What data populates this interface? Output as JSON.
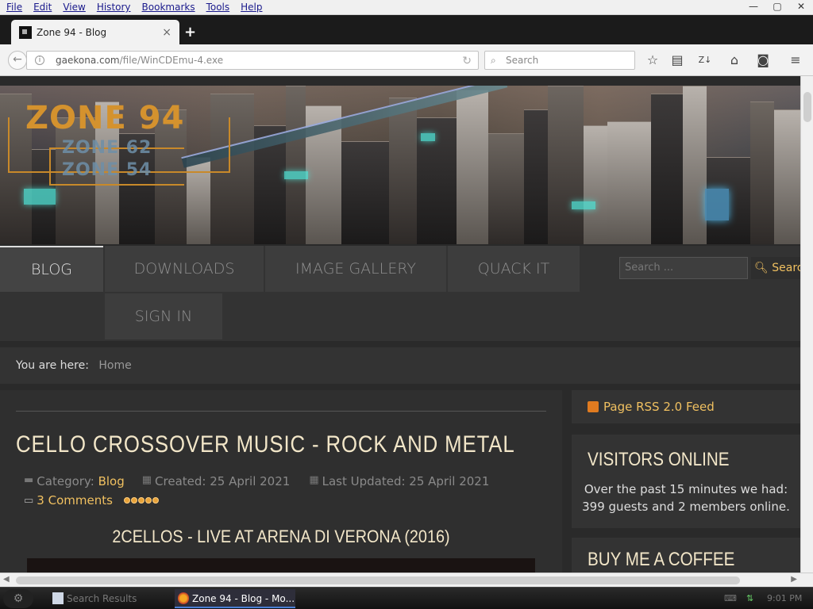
{
  "menubar": {
    "items": [
      "File",
      "Edit",
      "View",
      "History",
      "Bookmarks",
      "Tools",
      "Help"
    ],
    "minimize": "—",
    "maximize": "▢",
    "close": "✕"
  },
  "tab": {
    "title": "Zone 94 - Blog",
    "close": "×",
    "new_tab": "+"
  },
  "navbar": {
    "url_host": "gaekona.com",
    "url_path": "/file/WinCDEmu-4.exe",
    "search_placeholder": "Search"
  },
  "banner": {
    "logo_main": "ZONE 94",
    "logo_sub1": "ZONE 62",
    "logo_sub2": "ZONE 54"
  },
  "sitenav": {
    "items": [
      {
        "label": "BLOG",
        "active": true
      },
      {
        "label": "DOWNLOADS"
      },
      {
        "label": "IMAGE GALLERY"
      },
      {
        "label": "QUACK IT"
      },
      {
        "label": "SIGN IN"
      }
    ],
    "search_placeholder": "Search ...",
    "search_button": "Search"
  },
  "breadcrumb": {
    "prefix": "You are here:",
    "home": "Home"
  },
  "article": {
    "title": "CELLO CROSSOVER MUSIC - ROCK AND METAL",
    "category_label": "Category:",
    "category": "Blog",
    "created": "Created: 25 April 2021",
    "updated": "Last Updated: 25 April 2021",
    "comments": "3 Comments",
    "subheading": "2CELLOS - LIVE AT ARENA DI VERONA (2016)"
  },
  "sidebar": {
    "rss": "Page RSS 2.0 Feed",
    "visitors_title": "VISITORS ONLINE",
    "visitors_line1": "Over the past 15 minutes we had:",
    "visitors_line2": "399 guests and 2 members online.",
    "coffee_title": "BUY ME A COFFEE"
  },
  "taskbar": {
    "task1": "Search Results",
    "task2": "Zone 94 - Blog - Mo...",
    "clock": "9:01 PM"
  },
  "colors": {
    "accent": "#f0c060",
    "heading": "#f2e6c8",
    "page_bg": "#2a2a2a"
  }
}
